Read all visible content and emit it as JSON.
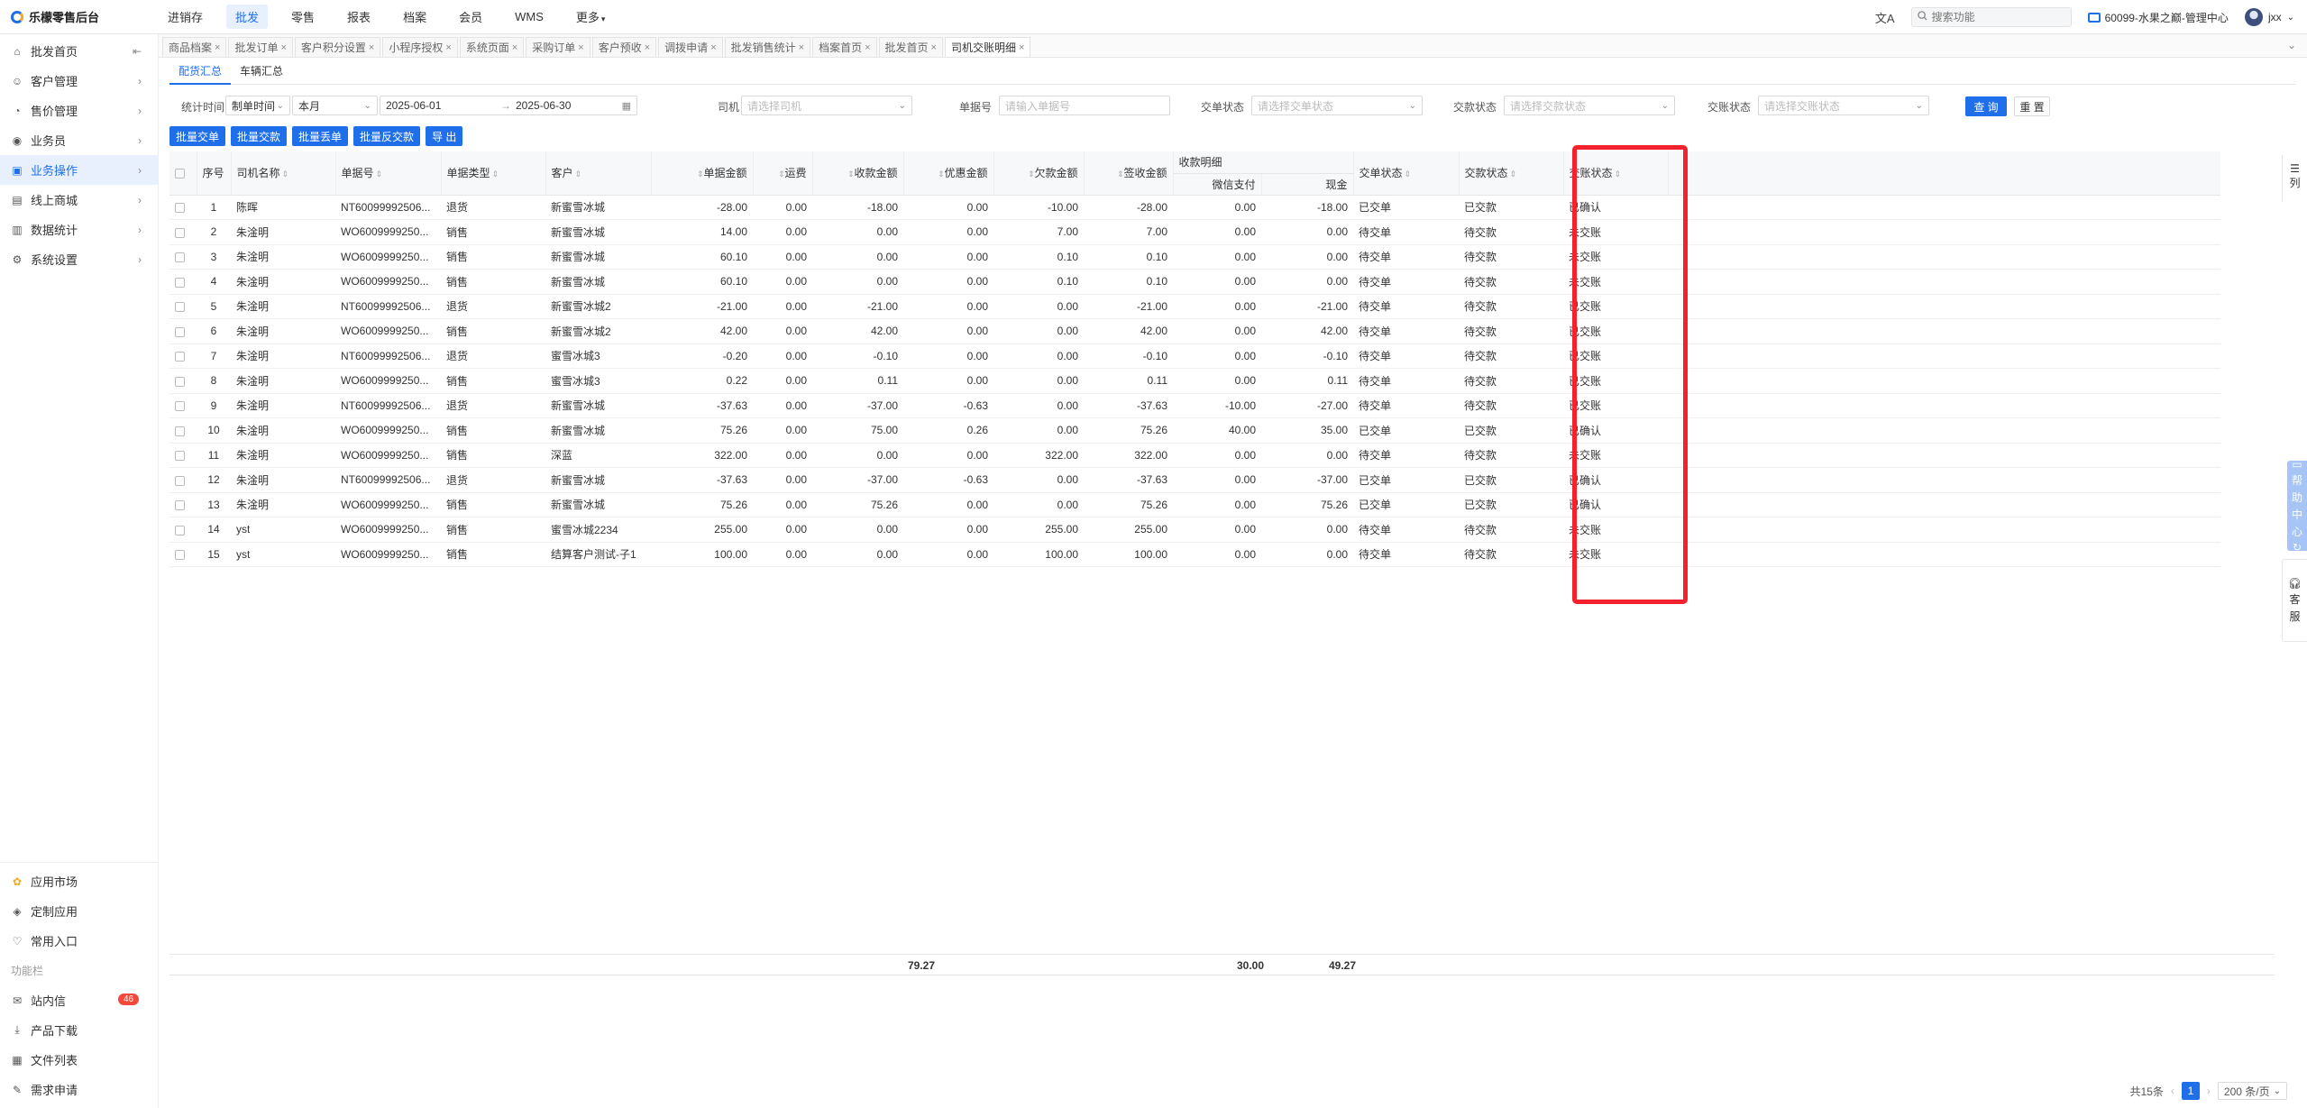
{
  "app": {
    "title": "乐檬零售后台"
  },
  "topnav": [
    "进销存",
    "批发",
    "零售",
    "报表",
    "档案",
    "会员",
    "WMS",
    "更多"
  ],
  "topnav_active": 1,
  "header": {
    "search_placeholder": "搜索功能",
    "org": "60099-水果之巅-管理中心",
    "user": "jxx"
  },
  "sidebar": {
    "items": [
      {
        "label": "批发首页",
        "icon": "home-icon",
        "chevron": false
      },
      {
        "label": "客户管理",
        "icon": "user-icon",
        "chevron": true
      },
      {
        "label": "售价管理",
        "icon": "price-icon",
        "chevron": true
      },
      {
        "label": "业务员",
        "icon": "person-icon",
        "chevron": true
      },
      {
        "label": "业务操作",
        "icon": "briefcase-icon",
        "chevron": true
      },
      {
        "label": "线上商城",
        "icon": "shop-icon",
        "chevron": true
      },
      {
        "label": "数据统计",
        "icon": "chart-icon",
        "chevron": true
      },
      {
        "label": "系统设置",
        "icon": "gear-icon",
        "chevron": true
      }
    ],
    "active": 4,
    "bottom": [
      "应用市场",
      "定制应用",
      "常用入口"
    ],
    "section": "功能栏",
    "tools": [
      "站内信",
      "产品下载",
      "文件列表",
      "需求申请"
    ],
    "badge": "46"
  },
  "tabs": [
    "商品档案",
    "批发订单",
    "客户积分设置",
    "小程序授权",
    "系统页面",
    "采购订单",
    "客户预收",
    "调拨申请",
    "批发销售统计",
    "档案首页",
    "批发首页",
    "司机交账明细"
  ],
  "active_tab": 11,
  "subtabs": [
    "配货汇总",
    "车辆汇总"
  ],
  "filters": {
    "stat_time_label": "统计时间",
    "time_type": "制单时间",
    "period": "本月",
    "date_from": "2025-06-01",
    "date_sep": "→",
    "date_to": "2025-06-30",
    "driver_label": "司机",
    "driver_ph": "请选择司机",
    "doc_label": "单据号",
    "doc_ph": "请输入单据号",
    "hand_label": "交单状态",
    "hand_ph": "请选择交单状态",
    "pay_label": "交款状态",
    "pay_ph": "请选择交款状态",
    "acct_label": "交账状态",
    "acct_ph": "请选择交账状态",
    "query": "查 询",
    "reset": "重 置"
  },
  "actions": [
    "批量交单",
    "批量交款",
    "批量丢单",
    "批量反交款",
    "导 出"
  ],
  "table": {
    "headers": {
      "seq": "序号",
      "driver": "司机名称",
      "doc": "单据号",
      "type": "单据类型",
      "customer": "客户",
      "amount": "单据金额",
      "freight": "运费",
      "received": "收款金额",
      "discount": "优惠金额",
      "owed": "欠款金额",
      "signed": "签收金额",
      "collect": "收款明细",
      "wechat": "微信支付",
      "cash": "现金",
      "hand": "交单状态",
      "pay": "交款状态",
      "acct": "交账状态"
    },
    "rows": [
      [
        "1",
        "陈晖",
        "NT60099992506...",
        "退货",
        "新蜜雪冰城",
        "-28.00",
        "0.00",
        "-18.00",
        "0.00",
        "-10.00",
        "-28.00",
        "0.00",
        "-18.00",
        "已交单",
        "已交款",
        "已确认"
      ],
      [
        "2",
        "朱淦明",
        "WO6009999250...",
        "销售",
        "新蜜雪冰城",
        "14.00",
        "0.00",
        "0.00",
        "0.00",
        "7.00",
        "7.00",
        "0.00",
        "0.00",
        "待交单",
        "待交款",
        "未交账"
      ],
      [
        "3",
        "朱淦明",
        "WO6009999250...",
        "销售",
        "新蜜雪冰城",
        "60.10",
        "0.00",
        "0.00",
        "0.00",
        "0.10",
        "0.10",
        "0.00",
        "0.00",
        "待交单",
        "待交款",
        "未交账"
      ],
      [
        "4",
        "朱淦明",
        "WO6009999250...",
        "销售",
        "新蜜雪冰城",
        "60.10",
        "0.00",
        "0.00",
        "0.00",
        "0.10",
        "0.10",
        "0.00",
        "0.00",
        "待交单",
        "待交款",
        "未交账"
      ],
      [
        "5",
        "朱淦明",
        "NT60099992506...",
        "退货",
        "新蜜雪冰城2",
        "-21.00",
        "0.00",
        "-21.00",
        "0.00",
        "0.00",
        "-21.00",
        "0.00",
        "-21.00",
        "待交单",
        "待交款",
        "已交账"
      ],
      [
        "6",
        "朱淦明",
        "WO6009999250...",
        "销售",
        "新蜜雪冰城2",
        "42.00",
        "0.00",
        "42.00",
        "0.00",
        "0.00",
        "42.00",
        "0.00",
        "42.00",
        "待交单",
        "待交款",
        "已交账"
      ],
      [
        "7",
        "朱淦明",
        "NT60099992506...",
        "退货",
        "蜜雪冰城3",
        "-0.20",
        "0.00",
        "-0.10",
        "0.00",
        "0.00",
        "-0.10",
        "0.00",
        "-0.10",
        "待交单",
        "待交款",
        "已交账"
      ],
      [
        "8",
        "朱淦明",
        "WO6009999250...",
        "销售",
        "蜜雪冰城3",
        "0.22",
        "0.00",
        "0.11",
        "0.00",
        "0.00",
        "0.11",
        "0.00",
        "0.11",
        "待交单",
        "待交款",
        "已交账"
      ],
      [
        "9",
        "朱淦明",
        "NT60099992506...",
        "退货",
        "新蜜雪冰城",
        "-37.63",
        "0.00",
        "-37.00",
        "-0.63",
        "0.00",
        "-37.63",
        "-10.00",
        "-27.00",
        "待交单",
        "待交款",
        "已交账"
      ],
      [
        "10",
        "朱淦明",
        "WO6009999250...",
        "销售",
        "新蜜雪冰城",
        "75.26",
        "0.00",
        "75.00",
        "0.26",
        "0.00",
        "75.26",
        "40.00",
        "35.00",
        "已交单",
        "已交款",
        "已确认"
      ],
      [
        "11",
        "朱淦明",
        "WO6009999250...",
        "销售",
        "深蓝",
        "322.00",
        "0.00",
        "0.00",
        "0.00",
        "322.00",
        "322.00",
        "0.00",
        "0.00",
        "待交单",
        "待交款",
        "未交账"
      ],
      [
        "12",
        "朱淦明",
        "NT60099992506...",
        "退货",
        "新蜜雪冰城",
        "-37.63",
        "0.00",
        "-37.00",
        "-0.63",
        "0.00",
        "-37.63",
        "0.00",
        "-37.00",
        "已交单",
        "已交款",
        "已确认"
      ],
      [
        "13",
        "朱淦明",
        "WO6009999250...",
        "销售",
        "新蜜雪冰城",
        "75.26",
        "0.00",
        "75.26",
        "0.00",
        "0.00",
        "75.26",
        "0.00",
        "75.26",
        "已交单",
        "已交款",
        "已确认"
      ],
      [
        "14",
        "yst",
        "WO6009999250...",
        "销售",
        "蜜雪冰城2234",
        "255.00",
        "0.00",
        "0.00",
        "0.00",
        "255.00",
        "255.00",
        "0.00",
        "0.00",
        "待交单",
        "待交款",
        "未交账"
      ],
      [
        "15",
        "yst",
        "WO6009999250...",
        "销售",
        "结算客户测试-子1",
        "100.00",
        "0.00",
        "0.00",
        "0.00",
        "100.00",
        "100.00",
        "0.00",
        "0.00",
        "待交单",
        "待交款",
        "未交账"
      ]
    ],
    "totals": {
      "received": "79.27",
      "wechat": "30.00",
      "cash": "49.27"
    }
  },
  "pager": {
    "total": "共15条",
    "current": "1",
    "size": "200 条/页"
  },
  "right_widgets": {
    "col_tab": "列",
    "blue": [
      "帮",
      "助",
      "中",
      "心"
    ],
    "kf": [
      "客",
      "服"
    ]
  },
  "colors": {
    "accent": "#1f6feb",
    "highlight": "#f5222d"
  }
}
